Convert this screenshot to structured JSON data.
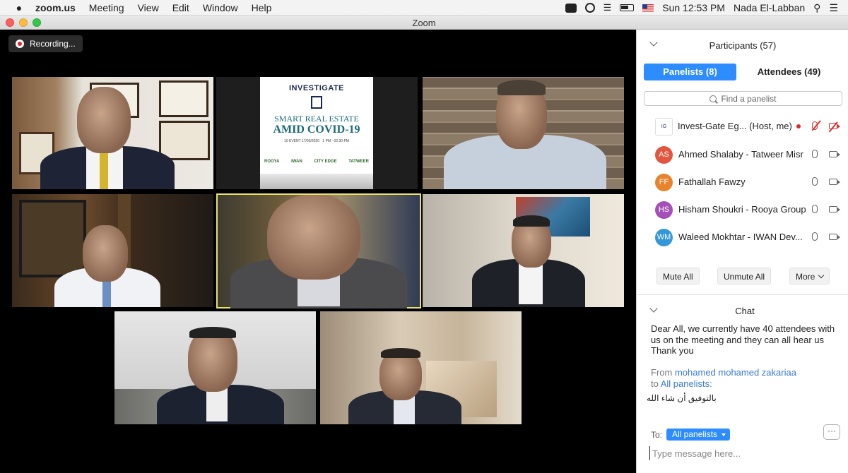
{
  "menubar": {
    "app_name": "zoom.us",
    "menus": [
      "Meeting",
      "View",
      "Edit",
      "Window",
      "Help"
    ],
    "clock": "Sun 12:53 PM",
    "user": "Nada El-Labban"
  },
  "window": {
    "title": "Zoom"
  },
  "recording": {
    "label": "Recording..."
  },
  "banner": {
    "logo": "INVESTIGATE",
    "title_line1": "SMART REAL ESTATE",
    "title_line2": "AMID COVID-19",
    "date": "10 EVENT 17/05/2020 · 1 PM - 02:30 PM",
    "sponsors": [
      "ROOYA",
      "IWAN",
      "CITY EDGE",
      "TATWEER"
    ]
  },
  "participants": {
    "title": "Participants (57)",
    "tab_panelists": "Panelists (8)",
    "tab_attendees": "Attendees (49)",
    "search_placeholder": "Find a panelist",
    "list": [
      {
        "initials": "IG",
        "name": "Invest-Gate Eg...",
        "suffix": "(Host, me)",
        "avatar_color": "#ffffff",
        "mic": "off",
        "video": "off",
        "recording": true
      },
      {
        "initials": "AS",
        "name": "Ahmed Shalaby - Tatweer Misr",
        "avatar_color": "#e2553f",
        "mic": "on",
        "video": "on"
      },
      {
        "initials": "FF",
        "name": "Fathallah Fawzy",
        "avatar_color": "#e8832d",
        "mic": "on",
        "video": "on"
      },
      {
        "initials": "HS",
        "name": "Hisham Shoukri - Rooya Group",
        "avatar_color": "#a54fb8",
        "mic": "on",
        "video": "on"
      },
      {
        "initials": "WM",
        "name": "Waleed Mokhtar - IWAN Dev...",
        "avatar_color": "#3397d8",
        "mic": "on",
        "video": "on"
      }
    ],
    "buttons": {
      "mute_all": "Mute All",
      "unmute_all": "Unmute All",
      "more": "More"
    }
  },
  "chat": {
    "title": "Chat",
    "message": "Dear All, we currently have 40 attendees with us on the meeting and they can all hear us Thank you",
    "from_prefix": "From",
    "from_name": "mohamed mohamed zakariaa",
    "to_prefix": "to",
    "to_name": "All panelists:",
    "arabic_message": "بالتوفيق أن شاء الله",
    "to_label": "To:",
    "to_value": "All panelists",
    "more_label": "···",
    "input_placeholder": "Type message here..."
  },
  "colors": {
    "accent": "#2d8cff",
    "active_speaker": "#e8e16b",
    "record": "#e0282e"
  }
}
